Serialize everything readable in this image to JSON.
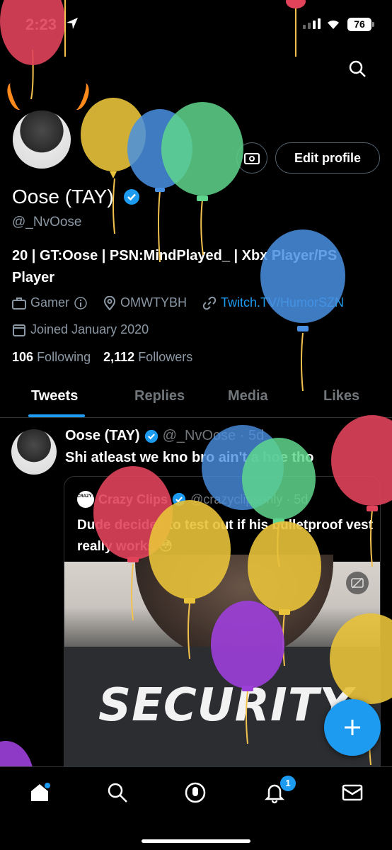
{
  "status_bar": {
    "time": "2:23",
    "battery": "76"
  },
  "profile": {
    "edit_label": "Edit profile",
    "display_name": "Oose (TAY)",
    "handle": "@_NvOose",
    "bio": "20 | GT:Oose | PSN:MindPlayed_ | Xbx Player/PS Player",
    "category": "Gamer",
    "location": "OMWTYBH",
    "website": "Twitch.TV/HumorSZN",
    "joined": "Joined January 2020",
    "following_count": "106",
    "following_label": "Following",
    "followers_count": "2,112",
    "followers_label": "Followers"
  },
  "tabs": [
    "Tweets",
    "Replies",
    "Media",
    "Likes"
  ],
  "tweet": {
    "name": "Oose (TAY)",
    "handle": "@_NvOose · 5d",
    "text": "Shi atleast we kno bro ain't a hoe tho",
    "quote": {
      "logo_text": "CRAZY CLIPS",
      "name": "Crazy Clips",
      "handle": "@crazyclipsonly · 5d",
      "text": "Dude decides to test out if his bulletproof vest really works 😳",
      "media_text": "SECURITY"
    }
  },
  "nav": {
    "notification_count": "1"
  },
  "colors": {
    "accent": "#1d9bf0",
    "background": "#000000",
    "muted": "#71767b"
  }
}
